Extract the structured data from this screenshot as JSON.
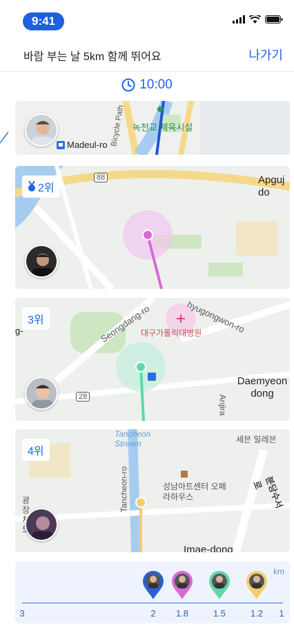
{
  "status": {
    "time": "9:41"
  },
  "header": {
    "title": "바람 부는 날 5km 함께 뛰어요",
    "exit_label": "나가기"
  },
  "timer": {
    "value": "10:00"
  },
  "cards": [
    {
      "rank": "",
      "labels": {
        "road": "Madeul-ro",
        "path": "Bicycle Path",
        "facility": "녹천교 체육시설"
      }
    },
    {
      "rank": "2위",
      "labels": {
        "area": "Apguj do",
        "route": "88"
      }
    },
    {
      "rank": "3위",
      "labels": {
        "road1": "Seongdang-ro",
        "road2": "hyugongwon-ro",
        "hospital": "대구가톨릭대병원",
        "area": "Daemyeon dong",
        "route": "28",
        "road3": "Anjira",
        "edge": "g-"
      }
    },
    {
      "rank": "4위",
      "labels": {
        "stream": "Tancheon Stream",
        "road": "Tancheon-ro",
        "center": "성남아트센터 오페라하우스",
        "right": "세븐 일레븐",
        "area": "Imae-dong",
        "vertical": "광장 차도",
        "diag": "분당수서로"
      }
    }
  ],
  "progress": {
    "unit": "km",
    "ticks": [
      "3",
      "2",
      "1.8",
      "1.5",
      "1.2",
      "1"
    ],
    "runners": [
      {
        "distance": 2,
        "color": "#2a5fd8"
      },
      {
        "distance": 1.8,
        "color": "#d86ad8"
      },
      {
        "distance": 1.5,
        "color": "#5fd8a8"
      },
      {
        "distance": 1.2,
        "color": "#f3cf6a"
      }
    ]
  },
  "colors": {
    "accent": "#1f64e6"
  }
}
